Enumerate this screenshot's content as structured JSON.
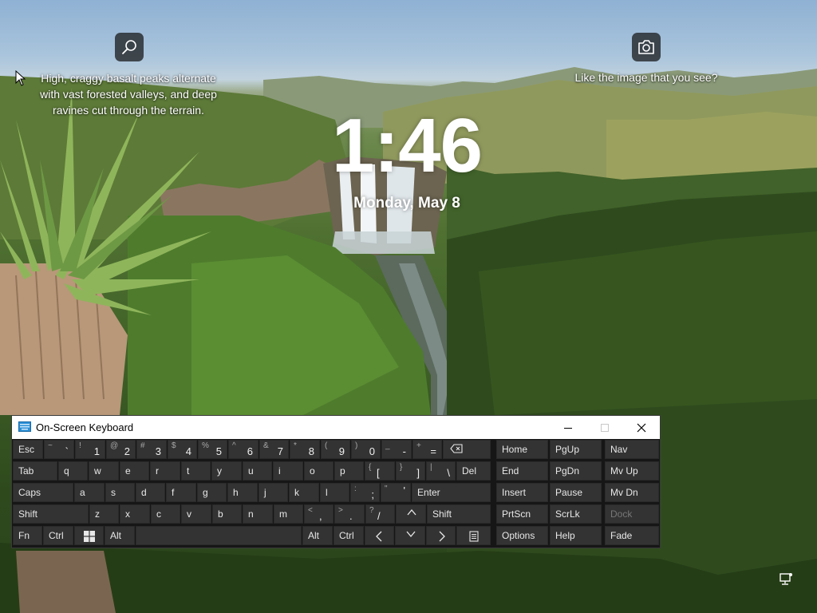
{
  "lock_screen": {
    "search_caption": "High, craggy basalt peaks alternate with vast forested valleys, and deep ravines cut through the terrain.",
    "camera_caption": "Like the image that you see?",
    "time": "1:46",
    "date": "Monday, May 8",
    "icons": {
      "search": "magnifier-icon",
      "camera": "camera-icon",
      "network": "network-icon",
      "cursor": "mouse-pointer"
    }
  },
  "osk": {
    "title": "On-Screen Keyboard",
    "title_icon": "keyboard-icon",
    "controls": {
      "minimize": "minimize-icon",
      "maximize": "maximize-icon",
      "close": "close-icon"
    },
    "row1": {
      "esc": "Esc",
      "tilde": {
        "sec": "~",
        "pri": "`"
      },
      "k1": {
        "sec": "!",
        "pri": "1"
      },
      "k2": {
        "sec": "@",
        "pri": "2"
      },
      "k3": {
        "sec": "#",
        "pri": "3"
      },
      "k4": {
        "sec": "$",
        "pri": "4"
      },
      "k5": {
        "sec": "%",
        "pri": "5"
      },
      "k6": {
        "sec": "^",
        "pri": "6"
      },
      "k7": {
        "sec": "&",
        "pri": "7"
      },
      "k8": {
        "sec": "*",
        "pri": "8"
      },
      "k9": {
        "sec": "(",
        "pri": "9"
      },
      "k0": {
        "sec": ")",
        "pri": "0"
      },
      "minus": {
        "sec": "_",
        "pri": "-"
      },
      "equals": {
        "sec": "+",
        "pri": "="
      },
      "backspace": "backspace-icon"
    },
    "row2": {
      "tab": "Tab",
      "letters": [
        "q",
        "w",
        "e",
        "r",
        "t",
        "y",
        "u",
        "i",
        "o",
        "p"
      ],
      "lbracket": {
        "sec": "{",
        "pri": "["
      },
      "rbracket": {
        "sec": "}",
        "pri": "]"
      },
      "backslash": {
        "sec": "|",
        "pri": "\\"
      },
      "del": "Del"
    },
    "row3": {
      "caps": "Caps",
      "letters": [
        "a",
        "s",
        "d",
        "f",
        "g",
        "h",
        "j",
        "k",
        "l"
      ],
      "semicolon": {
        "sec": ":",
        "pri": ";"
      },
      "quote": {
        "sec": "\"",
        "pri": "'"
      },
      "enter": "Enter"
    },
    "row4": {
      "shift_left": "Shift",
      "letters": [
        "z",
        "x",
        "c",
        "v",
        "b",
        "n",
        "m"
      ],
      "comma": {
        "sec": "<",
        "pri": ","
      },
      "period": {
        "sec": ">",
        "pri": "."
      },
      "slash": {
        "sec": "?",
        "pri": "/"
      },
      "up": "arrow-up-icon",
      "shift_right": "Shift"
    },
    "row5": {
      "fn": "Fn",
      "ctrl_left": "Ctrl",
      "win": "windows-logo-icon",
      "alt_left": "Alt",
      "alt_right": "Alt",
      "ctrl_right": "Ctrl",
      "left": "arrow-left-icon",
      "down": "arrow-down-icon",
      "right": "arrow-right-icon",
      "menu": "context-menu-icon"
    },
    "nav": {
      "home": "Home",
      "pgup": "PgUp",
      "navkey": "Nav",
      "end": "End",
      "pgdn": "PgDn",
      "mvup": "Mv Up",
      "insert": "Insert",
      "pause": "Pause",
      "mvdn": "Mv Dn",
      "prtscn": "PrtScn",
      "scrlk": "ScrLk",
      "dock": "Dock",
      "options": "Options",
      "help": "Help",
      "fade": "Fade"
    }
  }
}
